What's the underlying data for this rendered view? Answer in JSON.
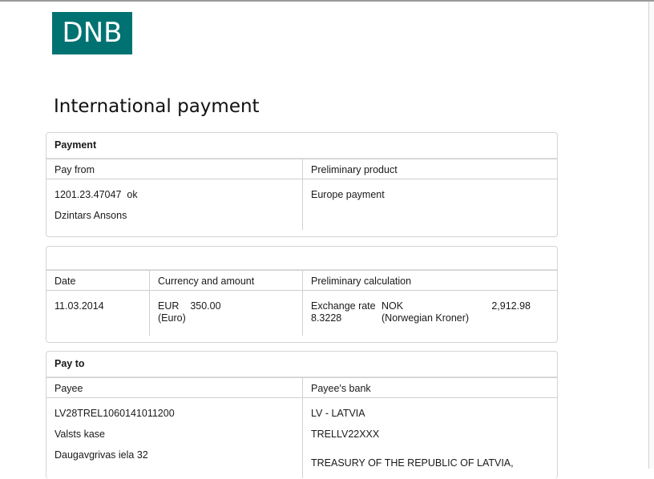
{
  "logo": {
    "text": "DNB"
  },
  "page_title": "International payment",
  "payment": {
    "title": "Payment",
    "pay_from_label": "Pay from",
    "preliminary_product_label": "Preliminary product",
    "account": "1201.23.47047",
    "account_status": "ok",
    "account_name": "Dzintars Ansons",
    "product": "Europe payment"
  },
  "details": {
    "date_label": "Date",
    "currency_label": "Currency and amount",
    "calc_label": "Preliminary calculation",
    "date": "11.03.2014",
    "currency_code": "EUR",
    "amount": "350.00",
    "currency_name": "(Euro)",
    "exchange_rate_label": "Exchange rate",
    "exchange_rate": "8.3228",
    "target_currency": "NOK",
    "target_currency_name": "(Norwegian Kroner)",
    "converted_amount": "2,912.98"
  },
  "pay_to": {
    "title": "Pay to",
    "payee_label": "Payee",
    "bank_label": "Payee's bank",
    "iban": "LV28TREL1060141011200",
    "payee_name": "Valsts kase",
    "payee_address": "Daugavgrivas iela 32",
    "bank_country": "LV - LATVIA",
    "bic": "TRELLV22XXX",
    "bank_name": "TREASURY OF THE REPUBLIC OF LATVIA,"
  },
  "colors": {
    "brand": "#007272",
    "border": "#d4d4d4"
  }
}
